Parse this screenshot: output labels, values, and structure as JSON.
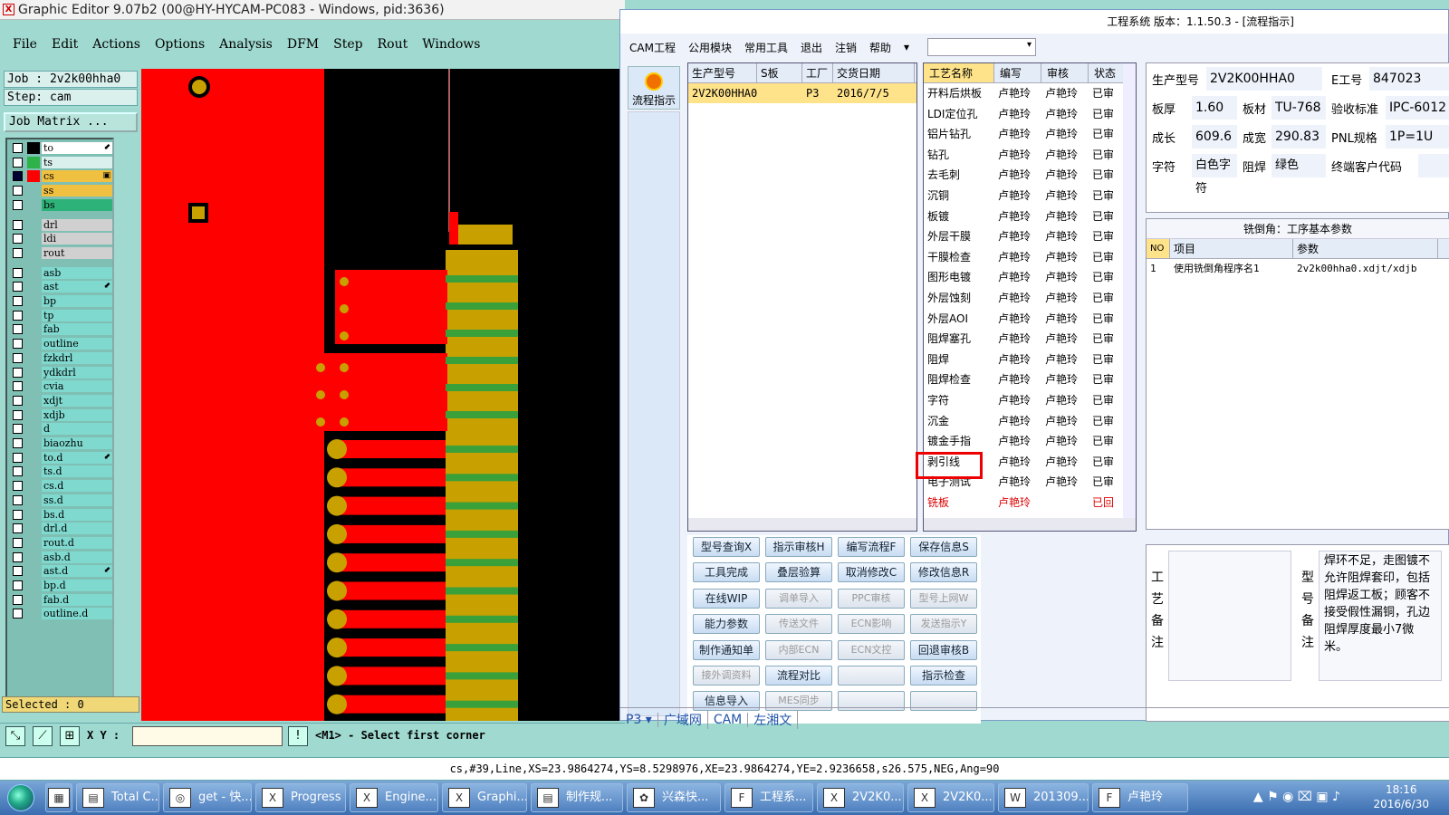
{
  "ge": {
    "title": "Graphic Editor 9.07b2 (00@HY-HYCAM-PC083 - Windows, pid:3636)",
    "menu": [
      "File",
      "Edit",
      "Actions",
      "Options",
      "Analysis",
      "DFM",
      "Step",
      "Rout",
      "Windows"
    ],
    "job": "Job : 2v2k00hha0",
    "step": "Step: cam",
    "matrix": "Job Matrix ...",
    "layers": [
      {
        "name": "to",
        "color": "#ffffff",
        "sw": "#000000",
        "mark": "⬋"
      },
      {
        "name": "ts",
        "color": "#d9f0ec",
        "sw": "#2db34a"
      },
      {
        "name": "cs",
        "color": "#f0c040",
        "sw": "#ff0000",
        "mark": "▣",
        "on": true
      },
      {
        "name": "ss",
        "color": "#f0c040",
        "sw": "#7fbfb4"
      },
      {
        "name": "bs",
        "color": "#2db37a",
        "sw": "#7fbfb4"
      },
      {
        "name": "drl",
        "color": "#d0d0d0",
        "sw": "#7fbfb4"
      },
      {
        "name": "ldi",
        "color": "#d0d0d0",
        "sw": "#7fbfb4"
      },
      {
        "name": "rout",
        "color": "#d0d0d0",
        "sw": "#7fbfb4"
      },
      {
        "name": "asb",
        "color": "#7fd9cf",
        "sw": "#7fbfb4"
      },
      {
        "name": "ast",
        "color": "#7fd9cf",
        "sw": "#7fbfb4",
        "mark": "⬋"
      },
      {
        "name": "bp",
        "color": "#7fd9cf",
        "sw": "#7fbfb4"
      },
      {
        "name": "tp",
        "color": "#7fd9cf",
        "sw": "#7fbfb4"
      },
      {
        "name": "fab",
        "color": "#7fd9cf",
        "sw": "#7fbfb4"
      },
      {
        "name": "outline",
        "color": "#7fd9cf",
        "sw": "#7fbfb4"
      },
      {
        "name": "fzkdrl",
        "color": "#7fd9cf",
        "sw": "#7fbfb4"
      },
      {
        "name": "ydkdrl",
        "color": "#7fd9cf",
        "sw": "#7fbfb4"
      },
      {
        "name": "cvia",
        "color": "#7fd9cf",
        "sw": "#7fbfb4"
      },
      {
        "name": "xdjt",
        "color": "#7fd9cf",
        "sw": "#7fbfb4"
      },
      {
        "name": "xdjb",
        "color": "#7fd9cf",
        "sw": "#7fbfb4"
      },
      {
        "name": "d",
        "color": "#7fd9cf",
        "sw": "#7fbfb4"
      },
      {
        "name": "biaozhu",
        "color": "#7fd9cf",
        "sw": "#7fbfb4"
      },
      {
        "name": "to.d",
        "color": "#7fd9cf",
        "sw": "#7fbfb4",
        "mark": "⬋"
      },
      {
        "name": "ts.d",
        "color": "#7fd9cf",
        "sw": "#7fbfb4"
      },
      {
        "name": "cs.d",
        "color": "#7fd9cf",
        "sw": "#7fbfb4"
      },
      {
        "name": "ss.d",
        "color": "#7fd9cf",
        "sw": "#7fbfb4"
      },
      {
        "name": "bs.d",
        "color": "#7fd9cf",
        "sw": "#7fbfb4"
      },
      {
        "name": "drl.d",
        "color": "#7fd9cf",
        "sw": "#7fbfb4"
      },
      {
        "name": "rout.d",
        "color": "#7fd9cf",
        "sw": "#7fbfb4"
      },
      {
        "name": "asb.d",
        "color": "#7fd9cf",
        "sw": "#7fbfb4"
      },
      {
        "name": "ast.d",
        "color": "#7fd9cf",
        "sw": "#7fbfb4",
        "mark": "⬋"
      },
      {
        "name": "bp.d",
        "color": "#7fd9cf",
        "sw": "#7fbfb4"
      },
      {
        "name": "fab.d",
        "color": "#7fd9cf",
        "sw": "#7fbfb4"
      },
      {
        "name": "outline.d",
        "color": "#7fd9cf",
        "sw": "#7fbfb4"
      }
    ],
    "selected": "Selected : 0",
    "xy_label": "X Y :",
    "prompt": "<M1> - Select first corner",
    "status": "cs,#39,Line,XS=23.9864274,YS=8.5298976,XE=23.9864274,YE=2.9236658,s26.575,NEG,Ang=90"
  },
  "es": {
    "title": "工程系统   版本：1.1.50.3 - [流程指示]",
    "menu": [
      "CAM工程",
      "公用模块",
      "常用工具",
      "退出",
      "注销",
      "帮助"
    ],
    "flow_btn": "流程指示",
    "orders_head": [
      "生产型号",
      "S板",
      "工厂",
      "交货日期"
    ],
    "order": [
      "2V2K00HHA0",
      "",
      "P3",
      "2016/7/5"
    ],
    "proc_head": [
      "工艺名称",
      "编写",
      "审核",
      "状态"
    ],
    "processes": [
      [
        "开料后烘板",
        "卢艳玲",
        "卢艳玲",
        "已审"
      ],
      [
        "LDI定位孔",
        "卢艳玲",
        "卢艳玲",
        "已审"
      ],
      [
        "铝片钻孔",
        "卢艳玲",
        "卢艳玲",
        "已审"
      ],
      [
        "钻孔",
        "卢艳玲",
        "卢艳玲",
        "已审"
      ],
      [
        "去毛刺",
        "卢艳玲",
        "卢艳玲",
        "已审"
      ],
      [
        "沉铜",
        "卢艳玲",
        "卢艳玲",
        "已审"
      ],
      [
        "板镀",
        "卢艳玲",
        "卢艳玲",
        "已审"
      ],
      [
        "外层干膜",
        "卢艳玲",
        "卢艳玲",
        "已审"
      ],
      [
        "干膜检查",
        "卢艳玲",
        "卢艳玲",
        "已审"
      ],
      [
        "图形电镀",
        "卢艳玲",
        "卢艳玲",
        "已审"
      ],
      [
        "外层蚀刻",
        "卢艳玲",
        "卢艳玲",
        "已审"
      ],
      [
        "外层AOI",
        "卢艳玲",
        "卢艳玲",
        "已审"
      ],
      [
        "阻焊塞孔",
        "卢艳玲",
        "卢艳玲",
        "已审"
      ],
      [
        "阻焊",
        "卢艳玲",
        "卢艳玲",
        "已审"
      ],
      [
        "阻焊检查",
        "卢艳玲",
        "卢艳玲",
        "已审"
      ],
      [
        "字符",
        "卢艳玲",
        "卢艳玲",
        "已审"
      ],
      [
        "沉金",
        "卢艳玲",
        "卢艳玲",
        "已审"
      ],
      [
        "镀金手指",
        "卢艳玲",
        "卢艳玲",
        "已审"
      ],
      [
        "剥引线",
        "卢艳玲",
        "卢艳玲",
        "已审"
      ],
      [
        "电子测试",
        "卢艳玲",
        "卢艳玲",
        "已审"
      ],
      [
        "铣板",
        "卢艳玲",
        "",
        "已回"
      ]
    ],
    "info": {
      "model_lbl": "生产型号",
      "model": "2V2K00HHA0",
      "eno_lbl": "E工号",
      "eno": "847023",
      "thick_lbl": "板厚",
      "thick": "1.60",
      "mat_lbl": "板材",
      "mat": "TU-768",
      "std_lbl": "验收标准",
      "std": "IPC-6012",
      "len_lbl": "成长",
      "len": "609.6",
      "wid_lbl": "成宽",
      "wid": "290.83",
      "pnl_lbl": "PNL规格",
      "pnl": "1P=1U",
      "char_lbl": "字符",
      "char": "白色字符",
      "mask_lbl": "阻焊",
      "mask": "绿色",
      "cust_lbl": "终端客户代码"
    },
    "param_title": "铣倒角：工序基本参数",
    "param_head": [
      "NO",
      "项目",
      "参数"
    ],
    "param_row": [
      "1",
      "使用铣倒角程序名1",
      "2v2k00hha0.xdjt/xdjb"
    ],
    "buttons": [
      [
        "型号查询X",
        "指示审核H",
        "编写流程F",
        "保存信息S"
      ],
      [
        "工具完成",
        "叠层验算",
        "取消修改C",
        "修改信息R"
      ],
      [
        "在线WIP",
        "调单导入",
        "PPC审核",
        "型号上网W"
      ],
      [
        "能力参数",
        "传送文件",
        "ECN影响",
        "发送指示Y"
      ],
      [
        "制作通知单",
        "内部ECN",
        "ECN文控",
        "回退审核B"
      ],
      [
        "接外调资料",
        "流程对比",
        "",
        "指示检查"
      ],
      [
        "信息导入",
        "MES同步",
        "",
        ""
      ]
    ],
    "remark_l": "工艺备注",
    "remark_r": "型号备注",
    "remark_text": "焊环不足，走图镀不允许阻焊套印，包括阻焊返工板；顾客不接受假性漏铜，孔边阻焊厚度最小7微米。",
    "tabs": [
      "P3 ▾",
      "广域网",
      "CAM",
      "左湘文"
    ]
  },
  "taskbar": {
    "items": [
      "Total C...",
      "get - 快...",
      "Progress",
      "Engine...",
      "Graphi...",
      "制作规...",
      "兴森快...",
      "工程系...",
      "2V2K0...",
      "2V2K0...",
      "201309...",
      "卢艳玲"
    ],
    "time": "18:16",
    "date": "2016/6/30"
  }
}
